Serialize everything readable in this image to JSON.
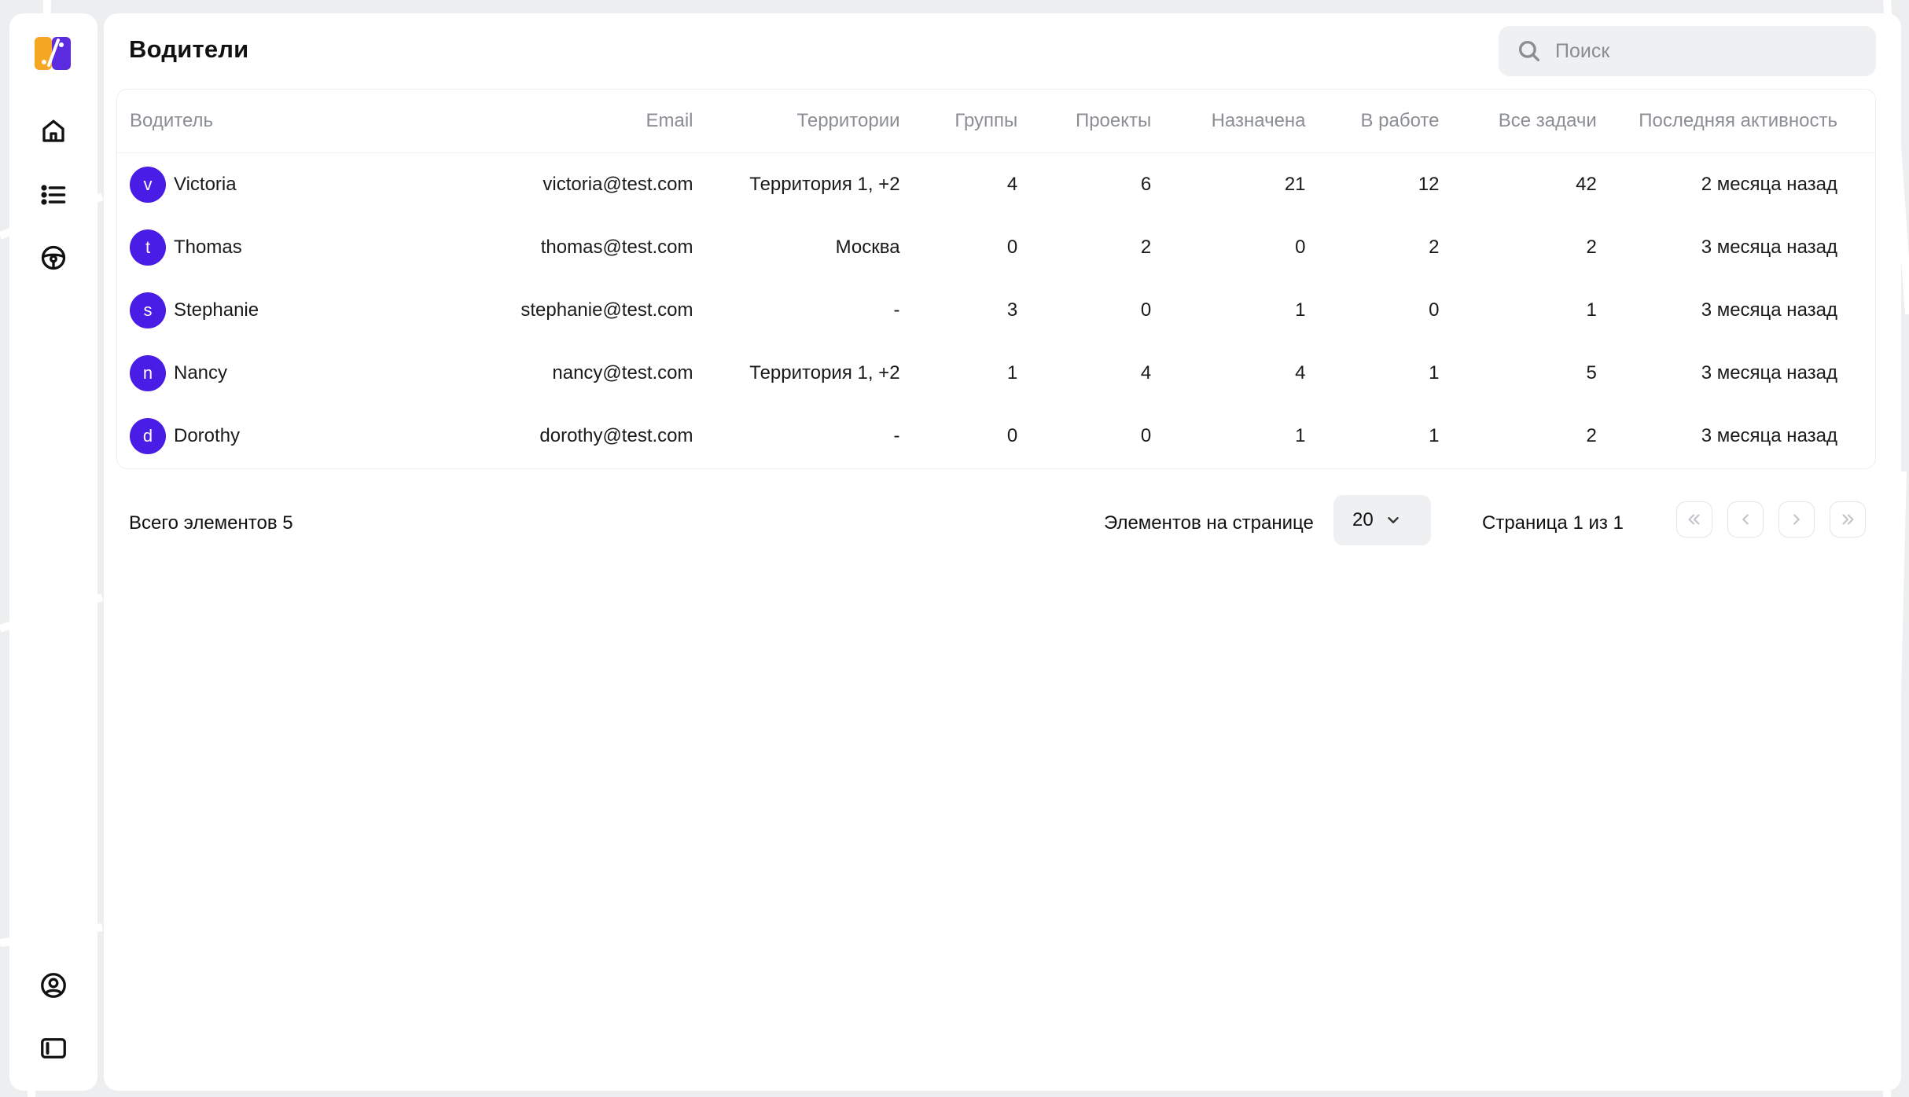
{
  "page": {
    "title": "Водители"
  },
  "search": {
    "placeholder": "Поиск"
  },
  "sidebar": {
    "items": [
      {
        "icon": "home-icon"
      },
      {
        "icon": "list-icon"
      },
      {
        "icon": "steering-wheel-icon"
      }
    ],
    "bottom": [
      {
        "icon": "user-circle-icon"
      },
      {
        "icon": "sidebar-toggle-icon"
      }
    ]
  },
  "colors": {
    "accent": "#4a1de6",
    "logo_orange": "#f5a623",
    "logo_purple": "#5b2be0"
  },
  "table": {
    "headers": [
      "Водитель",
      "Email",
      "Территории",
      "Группы",
      "Проекты",
      "Назначена",
      "В работе",
      "Все задачи",
      "Последняя активность"
    ],
    "rows": [
      {
        "initial": "v",
        "name": "Victoria",
        "email": "victoria@test.com",
        "territories": "Территория 1, +2",
        "groups": "4",
        "projects": "6",
        "assigned": "21",
        "in_progress": "12",
        "all_tasks": "42",
        "last_activity": "2 месяца назад"
      },
      {
        "initial": "t",
        "name": "Thomas",
        "email": "thomas@test.com",
        "territories": "Москва",
        "groups": "0",
        "projects": "2",
        "assigned": "0",
        "in_progress": "2",
        "all_tasks": "2",
        "last_activity": "3 месяца назад"
      },
      {
        "initial": "s",
        "name": "Stephanie",
        "email": "stephanie@test.com",
        "territories": "-",
        "groups": "3",
        "projects": "0",
        "assigned": "1",
        "in_progress": "0",
        "all_tasks": "1",
        "last_activity": "3 месяца назад"
      },
      {
        "initial": "n",
        "name": "Nancy",
        "email": "nancy@test.com",
        "territories": "Территория 1, +2",
        "groups": "1",
        "projects": "4",
        "assigned": "4",
        "in_progress": "1",
        "all_tasks": "5",
        "last_activity": "3 месяца назад"
      },
      {
        "initial": "d",
        "name": "Dorothy",
        "email": "dorothy@test.com",
        "territories": "-",
        "groups": "0",
        "projects": "0",
        "assigned": "1",
        "in_progress": "1",
        "all_tasks": "2",
        "last_activity": "3 месяца назад"
      }
    ]
  },
  "footer": {
    "total": "Всего элементов 5",
    "per_page_label": "Элементов на странице",
    "per_page_value": "20",
    "page_info": "Страница 1 из 1"
  }
}
